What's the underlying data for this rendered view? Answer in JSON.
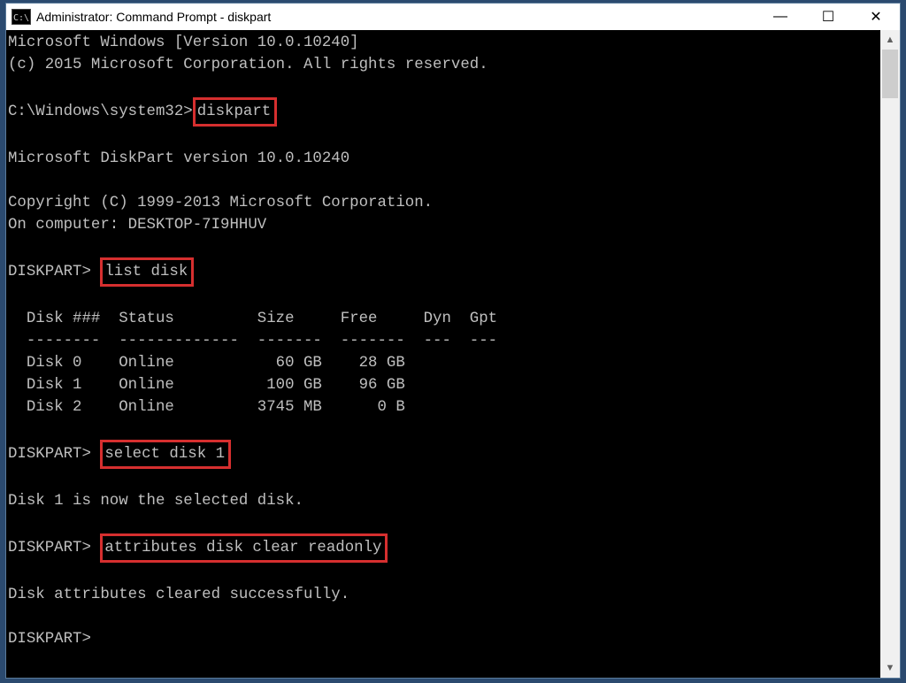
{
  "window": {
    "title": "Administrator: Command Prompt - diskpart",
    "controls": {
      "minimize": "—",
      "maximize": "☐",
      "close": "✕"
    }
  },
  "term": {
    "line_windows_ver": "Microsoft Windows [Version 10.0.10240]",
    "line_copyright": "(c) 2015 Microsoft Corporation. All rights reserved.",
    "prompt_sys32": "C:\\Windows\\system32>",
    "cmd_diskpart": "diskpart",
    "line_dpver": "Microsoft DiskPart version 10.0.10240",
    "line_dpcopy": "Copyright (C) 1999-2013 Microsoft Corporation.",
    "line_oncomputer": "On computer: DESKTOP-7I9HHUV",
    "prompt_dp": "DISKPART> ",
    "cmd_listdisk": "list disk",
    "table_header": "  Disk ###  Status         Size     Free     Dyn  Gpt",
    "table_divider": "  --------  -------------  -------  -------  ---  ---",
    "table_row0": "  Disk 0    Online           60 GB    28 GB",
    "table_row1": "  Disk 1    Online          100 GB    96 GB",
    "table_row2": "  Disk 2    Online         3745 MB      0 B",
    "cmd_select": "select disk 1",
    "line_selected": "Disk 1 is now the selected disk.",
    "cmd_attr": "attributes disk clear readonly",
    "line_cleared": "Disk attributes cleared successfully.",
    "prompt_final": "DISKPART>"
  },
  "scrollbar": {
    "up": "▲",
    "down": "▼"
  },
  "chart_data": {
    "type": "table",
    "title": "list disk",
    "columns": [
      "Disk ###",
      "Status",
      "Size",
      "Free",
      "Dyn",
      "Gpt"
    ],
    "rows": [
      [
        "Disk 0",
        "Online",
        "60 GB",
        "28 GB",
        "",
        ""
      ],
      [
        "Disk 1",
        "Online",
        "100 GB",
        "96 GB",
        "",
        ""
      ],
      [
        "Disk 2",
        "Online",
        "3745 MB",
        "0 B",
        "",
        ""
      ]
    ]
  }
}
